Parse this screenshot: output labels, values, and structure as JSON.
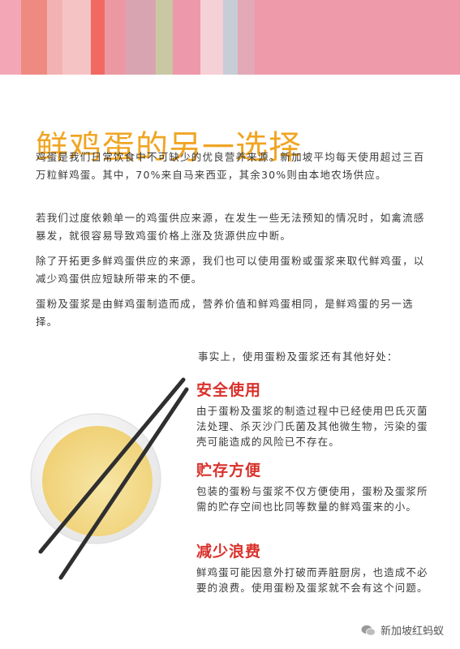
{
  "header": {
    "stripe_colors": [
      "#f3a7b6",
      "#ee8a80",
      "#f2b2b3",
      "#f6c3c4",
      "#f06a61",
      "#ec98a3",
      "#d9a4b2",
      "#c9c8a2",
      "#ee98ac",
      "#f5d0d6",
      "#c7cdd7",
      "#e3a9b7",
      "#ee9aaa"
    ]
  },
  "title": "鲜鸡蛋的另一选择",
  "paragraphs": [
    "鸡蛋是我们日常饮食中不可缺少的优良营养来源。新加坡平均每天使用超过三百万粒鲜鸡蛋。其中，70%来自马来西亚，其余30%则由本地农场供应。",
    "若我们过度依赖单一的鸡蛋供应来源，在发生一些无法预知的情况时，如禽流感暴发，就很容易导致鸡蛋价格上涨及货源供应中断。",
    "除了开拓更多鲜鸡蛋供应的来源，我们也可以使用蛋粉或蛋浆来取代鲜鸡蛋，以减少鸡蛋供应短缺所带来的不便。",
    "蛋粉及蛋浆是由鲜鸡蛋制造而成，营养价值和鲜鸡蛋相同，是鲜鸡蛋的另一选择。"
  ],
  "benefits_intro": "事实上，使用蛋粉及蛋浆还有其他好处：",
  "sections": [
    {
      "heading": "安全使用",
      "body": "由于蛋粉及蛋浆的制造过程中已经使用巴氏灭菌法处理、杀灭沙门氏菌及其他微生物，污染的蛋壳可能造成的风险已不存在。"
    },
    {
      "heading": "贮存方便",
      "body": "包装的蛋粉与蛋浆不仅方便使用，蛋粉及蛋浆所需的贮存空间也比同等数量的鲜鸡蛋来的小。"
    },
    {
      "heading": "减少浪费",
      "body": "鲜鸡蛋可能因意外打破而弄脏厨房，也造成不必要的浪费。使用蛋粉及蛋浆就不会有这个问题。"
    }
  ],
  "watermark": {
    "text": "新加坡红蚂蚁",
    "icon": "wechat-icon"
  },
  "colors": {
    "title": "#f0a523",
    "section_heading": "#d9312b",
    "body_text": "#3a3a3a",
    "egg_liquid": "#f2d887",
    "chopsticks": "#2f2f2f"
  }
}
